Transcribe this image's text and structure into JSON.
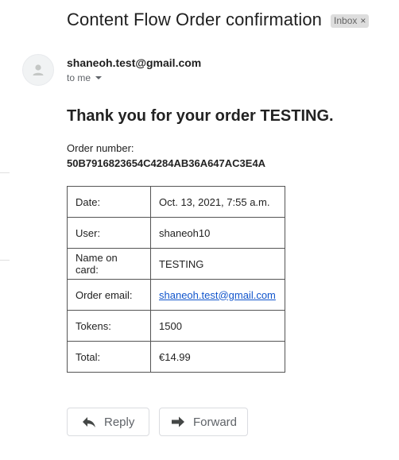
{
  "email": {
    "subject": "Content Flow Order confirmation",
    "label": {
      "text": "Inbox",
      "close_glyph": "×"
    },
    "sender": "shaneoh.test@gmail.com",
    "recipient": "to me",
    "heading": "Thank you for your order TESTING.",
    "order_number_label": "Order number:",
    "order_number": "50B7916823654C4284AB36A647AC3E4A",
    "details": [
      {
        "key": "Date:",
        "value": "Oct. 13, 2021, 7:55 a.m."
      },
      {
        "key": "User:",
        "value": "shaneoh10"
      },
      {
        "key": "Name on card:",
        "value": "TESTING"
      },
      {
        "key": "Order email:",
        "value": "shaneoh.test@gmail.com"
      },
      {
        "key": "Tokens:",
        "value": "1500"
      },
      {
        "key": "Total:",
        "value": "€14.99"
      }
    ]
  },
  "actions": {
    "reply_label": "Reply",
    "forward_label": "Forward"
  },
  "colors": {
    "link": "#1155cc",
    "label_chip_bg": "#dddddd",
    "table_border": "#555555"
  },
  "icons": {
    "avatar": "person-icon",
    "reply": "reply-icon",
    "forward": "forward-icon",
    "recipients_dropdown": "chevron-down-icon",
    "label_close": "close-icon"
  }
}
